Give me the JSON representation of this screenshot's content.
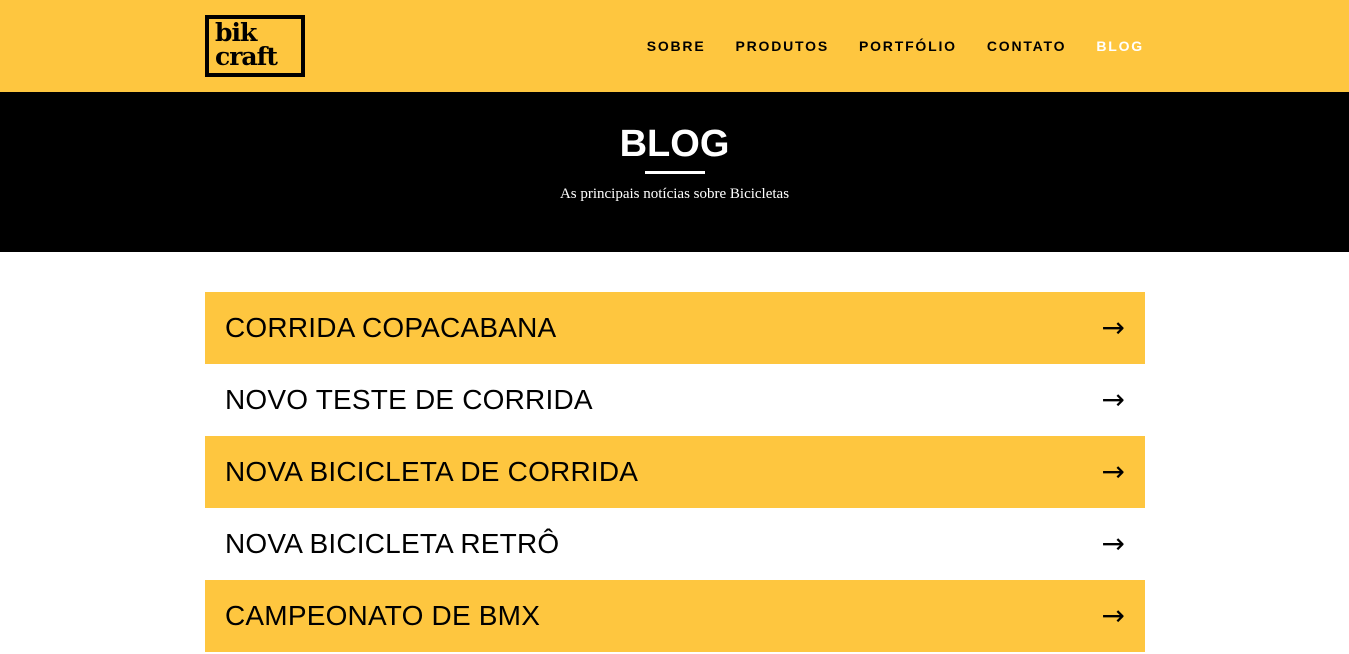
{
  "header": {
    "logo_line1": "bik",
    "logo_line2": "craft",
    "nav": [
      {
        "label": "SOBRE"
      },
      {
        "label": "PRODUTOS"
      },
      {
        "label": "PORTFÓLIO"
      },
      {
        "label": "CONTATO"
      },
      {
        "label": "BLOG"
      }
    ]
  },
  "hero": {
    "title": "BLOG",
    "subtitle": "As principais notícias sobre Bicicletas"
  },
  "posts": [
    {
      "title": "CORRIDA COPACABANA",
      "arrow": "→"
    },
    {
      "title": "NOVO TESTE DE CORRIDA",
      "arrow": "→"
    },
    {
      "title": "NOVA BICICLETA DE CORRIDA",
      "arrow": "→"
    },
    {
      "title": "NOVA BICICLETA RETRÔ",
      "arrow": "→"
    },
    {
      "title": "CAMPEONATO DE BMX",
      "arrow": "→"
    }
  ],
  "colors": {
    "brand_yellow": "#FEC63F",
    "dark": "#000000",
    "light": "#FFFFFF"
  }
}
